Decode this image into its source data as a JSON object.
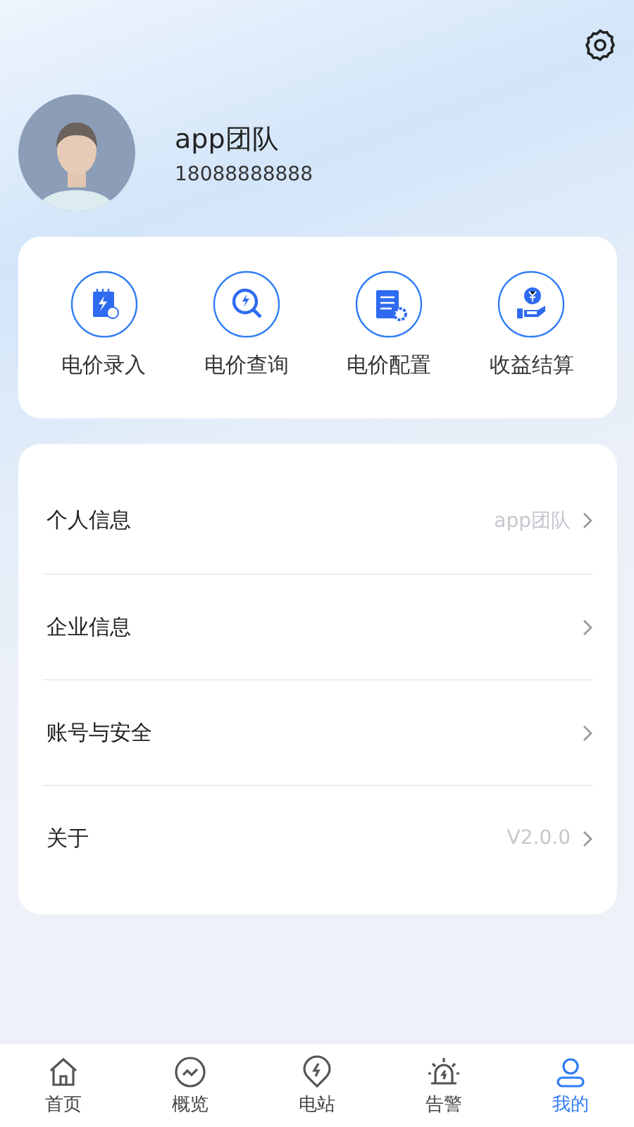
{
  "profile": {
    "name": "app团队",
    "phone": "18088888888"
  },
  "shortcuts": [
    {
      "kind": "entry",
      "label": "电价录入"
    },
    {
      "kind": "query",
      "label": "电价查询"
    },
    {
      "kind": "config",
      "label": "电价配置"
    },
    {
      "kind": "income",
      "label": "收益结算"
    }
  ],
  "menu": [
    {
      "label": "个人信息",
      "value": "app团队"
    },
    {
      "label": "企业信息"
    },
    {
      "label": "账号与安全"
    },
    {
      "label": "关于",
      "value": "V2.0.0"
    }
  ],
  "tabs": [
    {
      "kind": "home",
      "label": "首页",
      "selected": false
    },
    {
      "kind": "overview",
      "label": "概览",
      "selected": false
    },
    {
      "kind": "station",
      "label": "电站",
      "selected": false
    },
    {
      "kind": "alarm",
      "label": "告警",
      "selected": false
    },
    {
      "kind": "mine",
      "label": "我的",
      "selected": true
    }
  ]
}
